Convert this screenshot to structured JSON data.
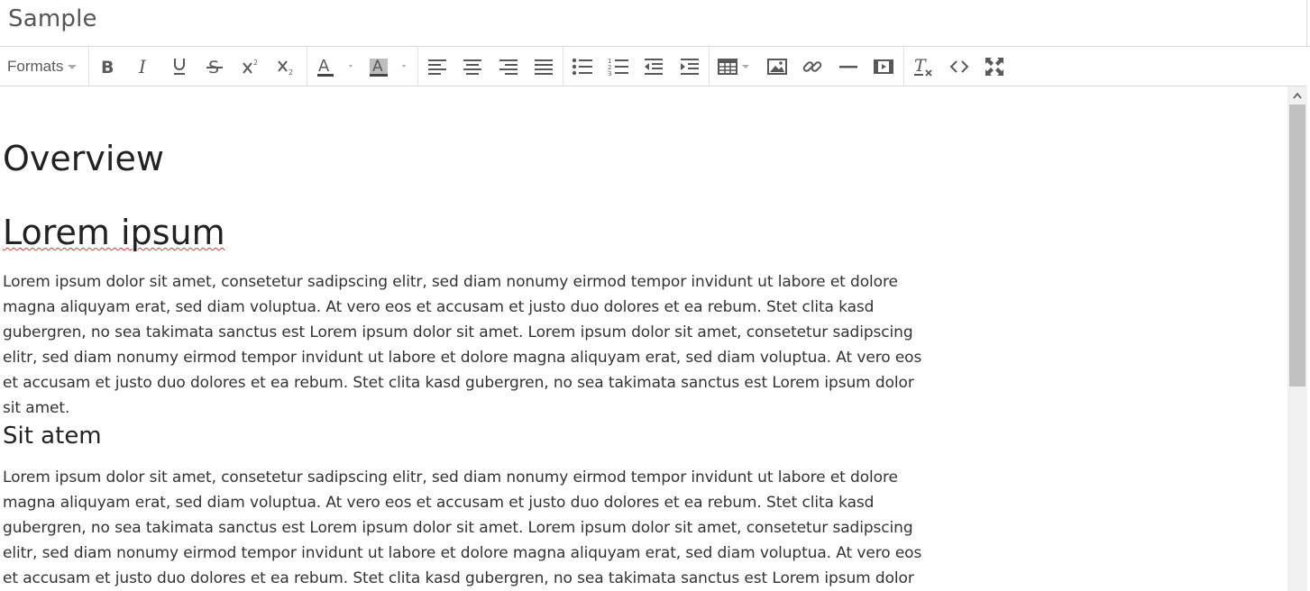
{
  "document": {
    "title": "Sample"
  },
  "toolbar": {
    "formats_label": "Formats",
    "buttons": [
      {
        "name": "bold-icon"
      },
      {
        "name": "italic-icon"
      },
      {
        "name": "underline-icon"
      },
      {
        "name": "strikethrough-icon"
      },
      {
        "name": "superscript-icon"
      },
      {
        "name": "subscript-icon"
      },
      {
        "name": "text-color-icon"
      },
      {
        "name": "background-color-icon"
      },
      {
        "name": "align-left-icon"
      },
      {
        "name": "align-center-icon"
      },
      {
        "name": "align-right-icon"
      },
      {
        "name": "align-justify-icon"
      },
      {
        "name": "bullet-list-icon"
      },
      {
        "name": "numbered-list-icon"
      },
      {
        "name": "outdent-icon"
      },
      {
        "name": "indent-icon"
      },
      {
        "name": "table-icon"
      },
      {
        "name": "image-icon"
      },
      {
        "name": "link-icon"
      },
      {
        "name": "horizontal-rule-icon"
      },
      {
        "name": "media-icon"
      },
      {
        "name": "clear-formatting-icon"
      },
      {
        "name": "source-code-icon"
      },
      {
        "name": "fullscreen-icon"
      }
    ]
  },
  "content": {
    "heading1": "Overview",
    "heading2": "Lorem ipsum",
    "paragraph1": "Lorem ipsum dolor sit amet, consetetur sadipscing elitr, sed diam nonumy eirmod tempor invidunt ut labore et dolore magna aliquyam erat, sed diam voluptua. At vero eos et accusam et justo duo dolores et ea rebum. Stet clita kasd gubergren, no sea takimata sanctus est Lorem ipsum dolor sit amet. Lorem ipsum dolor sit amet, consetetur sadipscing elitr, sed diam nonumy eirmod tempor invidunt ut labore et dolore magna aliquyam erat, sed diam voluptua. At vero eos et accusam et justo duo dolores et ea rebum. Stet clita kasd gubergren, no sea takimata sanctus est Lorem ipsum dolor sit amet.",
    "heading3": "Sit atem",
    "paragraph2": "Lorem ipsum dolor sit amet, consetetur sadipscing elitr, sed diam nonumy eirmod tempor invidunt ut labore et dolore magna aliquyam erat, sed diam voluptua. At vero eos et accusam et justo duo dolores et ea rebum. Stet clita kasd gubergren, no sea takimata sanctus est Lorem ipsum dolor sit amet. Lorem ipsum dolor sit amet, consetetur sadipscing elitr, sed diam nonumy eirmod tempor invidunt ut labore et dolore magna aliquyam erat, sed diam voluptua. At vero eos et accusam et justo duo dolores et ea rebum. Stet clita kasd gubergren, no sea takimata sanctus est Lorem ipsum dolor sit amet."
  },
  "colors": {
    "spellcheck_underline": "#e33",
    "toolbar_icon": "#595959",
    "border": "#d9d9d9"
  }
}
